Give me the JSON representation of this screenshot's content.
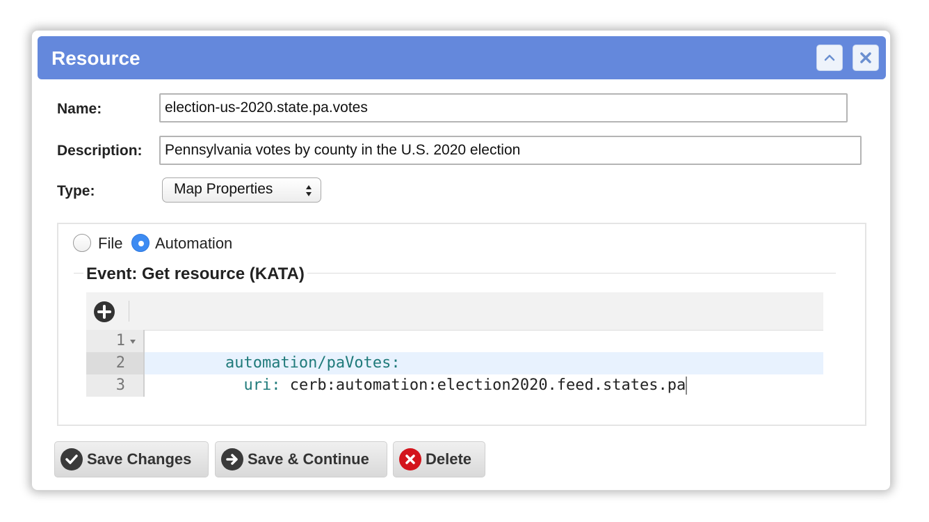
{
  "dialog": {
    "title": "Resource"
  },
  "form": {
    "name_label": "Name:",
    "name_value": "election-us-2020.state.pa.votes",
    "description_label": "Description:",
    "description_value": "Pennsylvania votes by county in the U.S. 2020 election",
    "type_label": "Type:",
    "type_selected": "Map Properties"
  },
  "source": {
    "options": [
      {
        "label": "File",
        "selected": false
      },
      {
        "label": "Automation",
        "selected": true
      }
    ],
    "legend": "Event: Get resource (KATA)"
  },
  "editor": {
    "lines": [
      {
        "number": "1",
        "key": "automation/paVotes:",
        "value": ""
      },
      {
        "number": "2",
        "key": "  uri:",
        "value": " cerb:automation:election2020.feed.states.pa"
      },
      {
        "number": "3",
        "key": "",
        "value": ""
      }
    ],
    "key_color": "#1f7a7a",
    "value_color": "#222222"
  },
  "buttons": {
    "save_changes": "Save Changes",
    "save_continue": "Save & Continue",
    "delete": "Delete"
  },
  "colors": {
    "titlebar": "#6488dc",
    "radio_selected": "#3d8bf2",
    "delete_icon": "#d3141c"
  }
}
